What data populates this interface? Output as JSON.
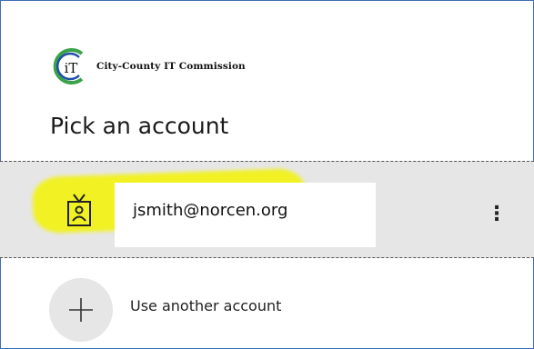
{
  "org": {
    "name": "City-County IT Commission",
    "logo_letters": "iT"
  },
  "dialog": {
    "title": "Pick an account"
  },
  "accounts": [
    {
      "email": "jsmith@norcen.org",
      "more_label": "⋮",
      "icon": "badge-icon"
    }
  ],
  "add_account": {
    "label": "Use another account",
    "icon": "plus-icon"
  },
  "colors": {
    "highlight": "#f2f21a",
    "row_background": "#e6e6e6",
    "logo_green": "#3aa34a",
    "logo_blue": "#1f4fa8"
  }
}
